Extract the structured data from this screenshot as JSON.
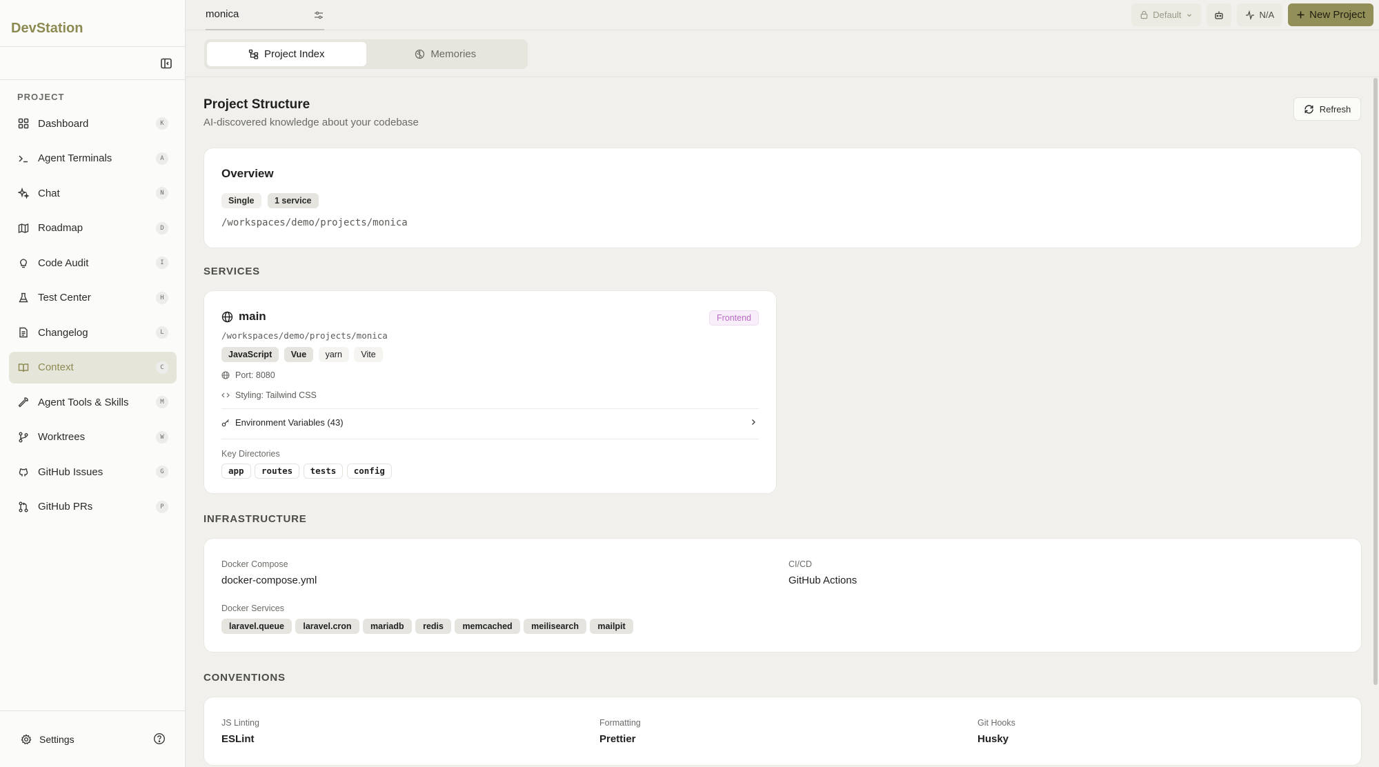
{
  "app": {
    "brand": "DevStation"
  },
  "sidebar": {
    "section_label": "PROJECT",
    "items": [
      {
        "label": "Dashboard",
        "key": "K",
        "icon": "dashboard-icon"
      },
      {
        "label": "Agent Terminals",
        "key": "A",
        "icon": "terminal-icon"
      },
      {
        "label": "Chat",
        "key": "N",
        "icon": "sparkles-icon"
      },
      {
        "label": "Roadmap",
        "key": "D",
        "icon": "map-icon"
      },
      {
        "label": "Code Audit",
        "key": "I",
        "icon": "lightbulb-icon"
      },
      {
        "label": "Test Center",
        "key": "H",
        "icon": "flask-icon"
      },
      {
        "label": "Changelog",
        "key": "L",
        "icon": "file-text-icon"
      },
      {
        "label": "Context",
        "key": "C",
        "icon": "book-icon",
        "active": true
      },
      {
        "label": "Agent Tools & Skills",
        "key": "M",
        "icon": "wrench-icon"
      },
      {
        "label": "Worktrees",
        "key": "W",
        "icon": "git-branch-icon"
      },
      {
        "label": "GitHub Issues",
        "key": "G",
        "icon": "github-icon"
      },
      {
        "label": "GitHub PRs",
        "key": "P",
        "icon": "git-pull-request-icon"
      }
    ],
    "settings_label": "Settings"
  },
  "topbar": {
    "project_tab": "monica",
    "default_label": "Default",
    "status_label": "N/A",
    "new_project_label": "New Project"
  },
  "subtabs": [
    {
      "label": "Project Index",
      "active": true
    },
    {
      "label": "Memories",
      "active": false
    }
  ],
  "page": {
    "title": "Project Structure",
    "subtitle": "AI-discovered knowledge about your codebase",
    "refresh_label": "Refresh"
  },
  "overview": {
    "heading": "Overview",
    "badges": [
      "Single",
      "1 service"
    ],
    "path": "/workspaces/demo/projects/monica"
  },
  "services": {
    "heading": "SERVICES",
    "main": {
      "name": "main",
      "type_badge": "Frontend",
      "path": "/workspaces/demo/projects/monica",
      "tags": [
        "JavaScript",
        "Vue",
        "yarn",
        "Vite"
      ],
      "port": "Port: 8080",
      "styling": "Styling: Tailwind CSS",
      "env_vars": "Environment Variables (43)",
      "key_dirs_label": "Key Directories",
      "key_dirs": [
        "app",
        "routes",
        "tests",
        "config"
      ]
    }
  },
  "infrastructure": {
    "heading": "INFRASTRUCTURE",
    "docker_compose_label": "Docker Compose",
    "docker_compose_value": "docker-compose.yml",
    "cicd_label": "CI/CD",
    "cicd_value": "GitHub Actions",
    "docker_services_label": "Docker Services",
    "docker_services": [
      "laravel.queue",
      "laravel.cron",
      "mariadb",
      "redis",
      "memcached",
      "meilisearch",
      "mailpit"
    ]
  },
  "conventions": {
    "heading": "CONVENTIONS",
    "items": [
      {
        "label": "JS Linting",
        "value": "ESLint"
      },
      {
        "label": "Formatting",
        "value": "Prettier"
      },
      {
        "label": "Git Hooks",
        "value": "Husky"
      }
    ]
  },
  "colors": {
    "accent": "#938f58",
    "brand": "#8c8a52",
    "frontend_badge": "#b86ac3"
  }
}
